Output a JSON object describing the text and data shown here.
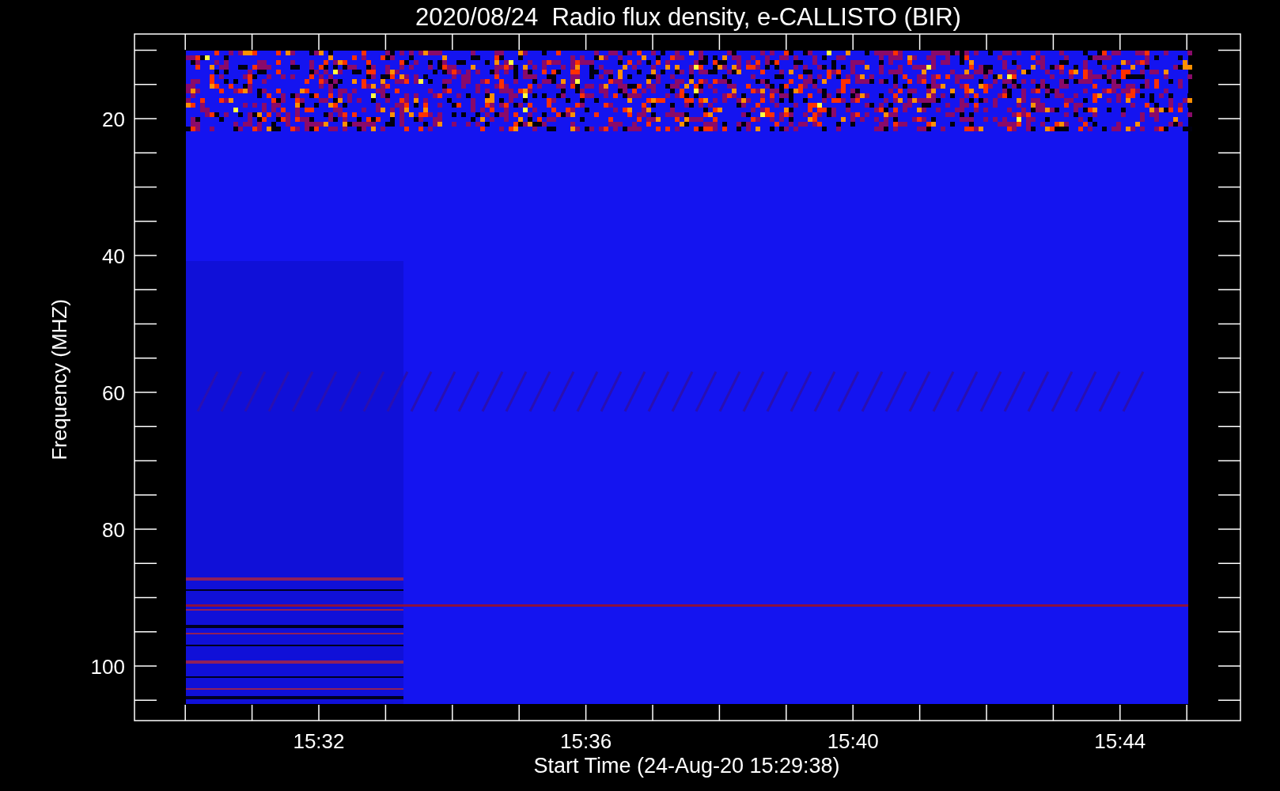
{
  "title": "2020/08/24  Radio flux density, e-CALLISTO (BIR)",
  "y_axis": {
    "label": "Frequency (MHZ)",
    "ticks": [
      "20",
      "40",
      "60",
      "80",
      "100"
    ]
  },
  "x_axis": {
    "label": "Start Time (24-Aug-20 15:29:38)",
    "ticks": [
      "15:32",
      "15:36",
      "15:40",
      "15:44"
    ]
  }
}
